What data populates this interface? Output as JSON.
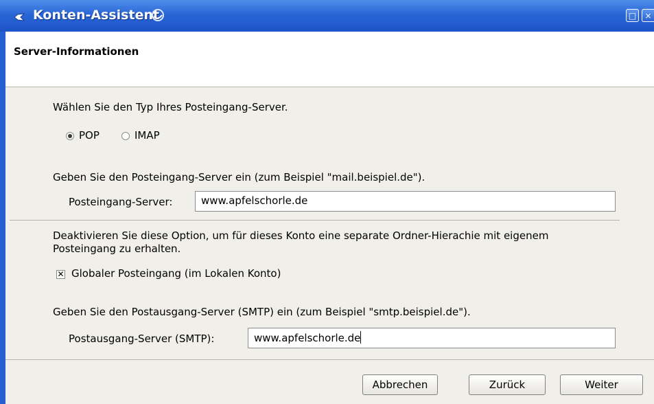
{
  "window": {
    "title": "Konten-Assistent",
    "header_title": "Server-Informationen"
  },
  "incoming_type": {
    "prompt": "Wählen Sie den Typ Ihres Posteingang-Server.",
    "options": [
      {
        "label": "POP",
        "selected": true
      },
      {
        "label": "IMAP",
        "selected": false
      }
    ]
  },
  "incoming_server": {
    "instruction": "Geben Sie den Posteingang-Server ein (zum Beispiel \"mail.beispiel.de\").",
    "label": "Posteingang-Server:",
    "value": "www.apfelschorle.de"
  },
  "global_inbox": {
    "description_line1": "Deaktivieren Sie diese Option, um für dieses Konto eine separate Ordner-Hierachie mit eigenem",
    "description_line2": "Posteingang zu erhalten.",
    "checkbox_label": "Globaler Posteingang (im Lokalen Konto)",
    "checked": true
  },
  "outgoing_server": {
    "instruction": "Geben Sie den Postausgang-Server (SMTP) ein (zum Beispiel \"smtp.beispiel.de\").",
    "label": "Postausgang-Server (SMTP):",
    "value": "www.apfelschorle.de"
  },
  "buttons": {
    "cancel": "Abbrechen",
    "back": "Zurück",
    "next": "Weiter"
  }
}
